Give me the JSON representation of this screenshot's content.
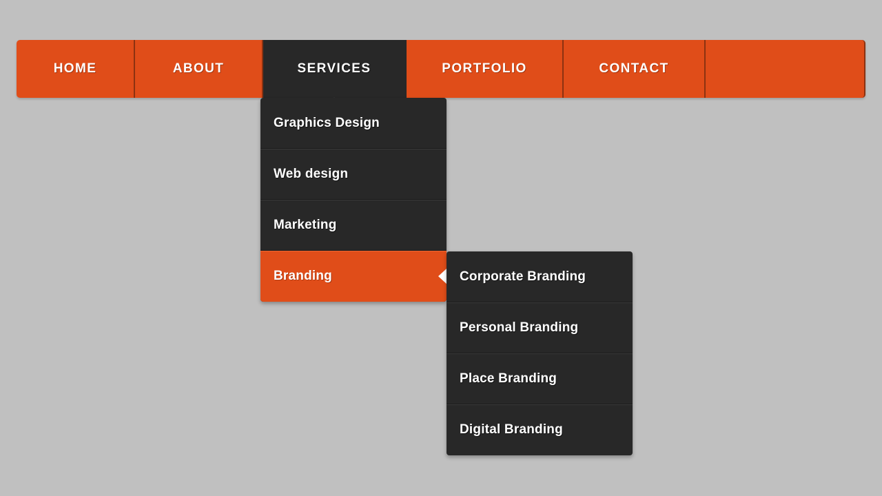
{
  "colors": {
    "accent": "#e04d19",
    "dark": "#282828",
    "page_background": "#c0c0c0",
    "divider": "#8c3211",
    "text": "#ffffff"
  },
  "navbar": {
    "items": [
      {
        "label": "HOME",
        "active": false
      },
      {
        "label": "ABOUT",
        "active": false
      },
      {
        "label": "SERVICES",
        "active": true
      },
      {
        "label": "PORTFOLIO",
        "active": false
      },
      {
        "label": "CONTACT",
        "active": false
      }
    ]
  },
  "dropdown": {
    "parent": "SERVICES",
    "items": [
      {
        "label": "Graphics Design",
        "highlighted": false,
        "has_submenu": false
      },
      {
        "label": "Web design",
        "highlighted": false,
        "has_submenu": false
      },
      {
        "label": "Marketing",
        "highlighted": false,
        "has_submenu": false
      },
      {
        "label": "Branding",
        "highlighted": true,
        "has_submenu": true
      }
    ]
  },
  "submenu": {
    "parent": "Branding",
    "items": [
      {
        "label": "Corporate Branding"
      },
      {
        "label": "Personal Branding"
      },
      {
        "label": "Place Branding"
      },
      {
        "label": "Digital Branding"
      }
    ]
  },
  "icons": {
    "dropdown_caret": "caret-up-icon",
    "submenu_arrow": "caret-left-icon"
  }
}
